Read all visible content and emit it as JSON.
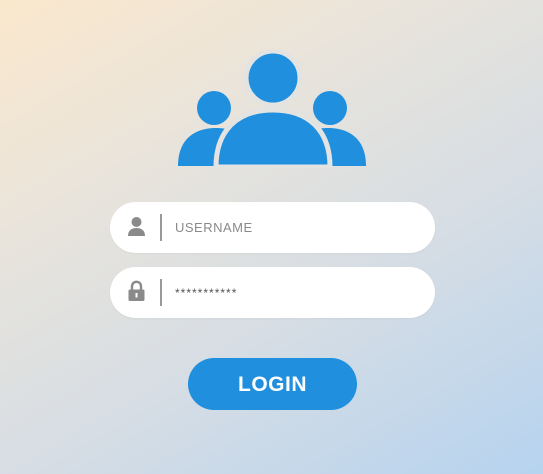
{
  "colors": {
    "accent": "#1f8fde",
    "field_background": "#ffffff",
    "icon_gray": "#8a8a8a"
  },
  "logo": {
    "icon": "users-group-icon"
  },
  "username": {
    "icon": "user-icon",
    "placeholder": "USERNAME"
  },
  "password": {
    "icon": "lock-icon",
    "value": "***********"
  },
  "login": {
    "label": "LOGIN"
  }
}
